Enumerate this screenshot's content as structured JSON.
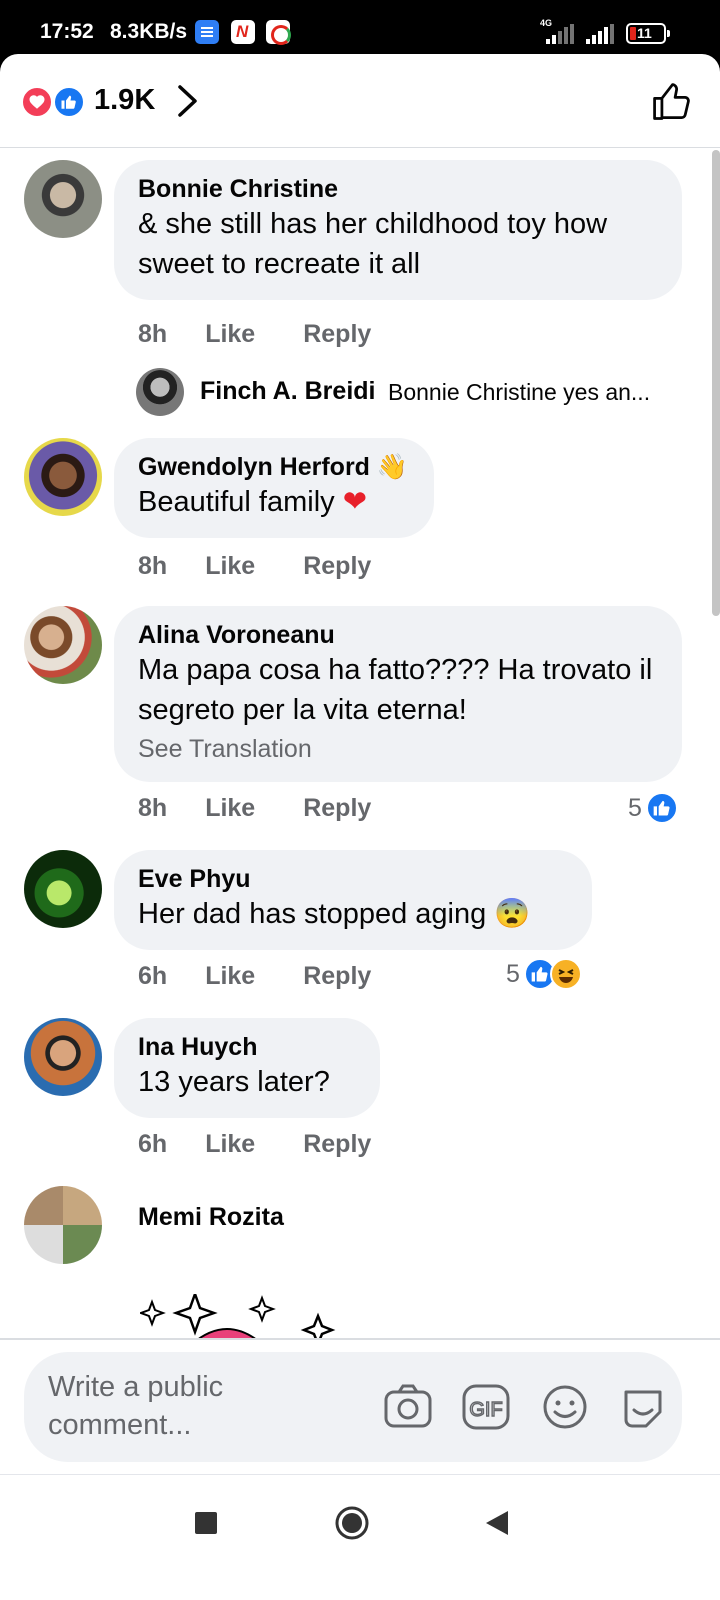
{
  "status_bar": {
    "time": "17:52",
    "speed": "8.3KB/s",
    "network": "4G",
    "battery": "11"
  },
  "reactions_bar": {
    "count": "1.9K",
    "icons": [
      "love-icon",
      "like-icon"
    ]
  },
  "comments": [
    {
      "name": "Bonnie Christine",
      "text": "& she still has her childhood toy  how sweet to recreate it all",
      "time": "8h",
      "like_label": "Like",
      "reply_label": "Reply",
      "reply": {
        "name": "Finch A. Breidi",
        "text": "Bonnie Christine yes an..."
      }
    },
    {
      "name": "Gwendolyn Herford",
      "name_emoji": "👋",
      "text": "Beautiful family",
      "text_emoji": "❤",
      "time": "8h",
      "like_label": "Like",
      "reply_label": "Reply"
    },
    {
      "name": "Alina Voroneanu",
      "text": "Ma papa cosa ha fatto???? Ha trovato il segreto per la vita eterna!",
      "translation": "See Translation",
      "time": "8h",
      "like_label": "Like",
      "reply_label": "Reply",
      "reaction_count": "5"
    },
    {
      "name": "Eve Phyu",
      "text": "Her dad has stopped aging",
      "text_emoji": "😨",
      "time": "6h",
      "like_label": "Like",
      "reply_label": "Reply",
      "reaction_count": "5"
    },
    {
      "name": "Ina Huych",
      "text": "13 years later?",
      "time": "6h",
      "like_label": "Like",
      "reply_label": "Reply"
    },
    {
      "name": "Memi Rozita"
    }
  ],
  "composer": {
    "placeholder": "Write a public comment...",
    "icons": [
      "camera-icon",
      "gif-icon",
      "emoji-icon",
      "sticker-icon"
    ]
  },
  "colors": {
    "like_blue": "#1877f2",
    "love_red": "#f33e58",
    "bubble_bg": "#f0f2f5",
    "meta_gray": "#65676b"
  }
}
